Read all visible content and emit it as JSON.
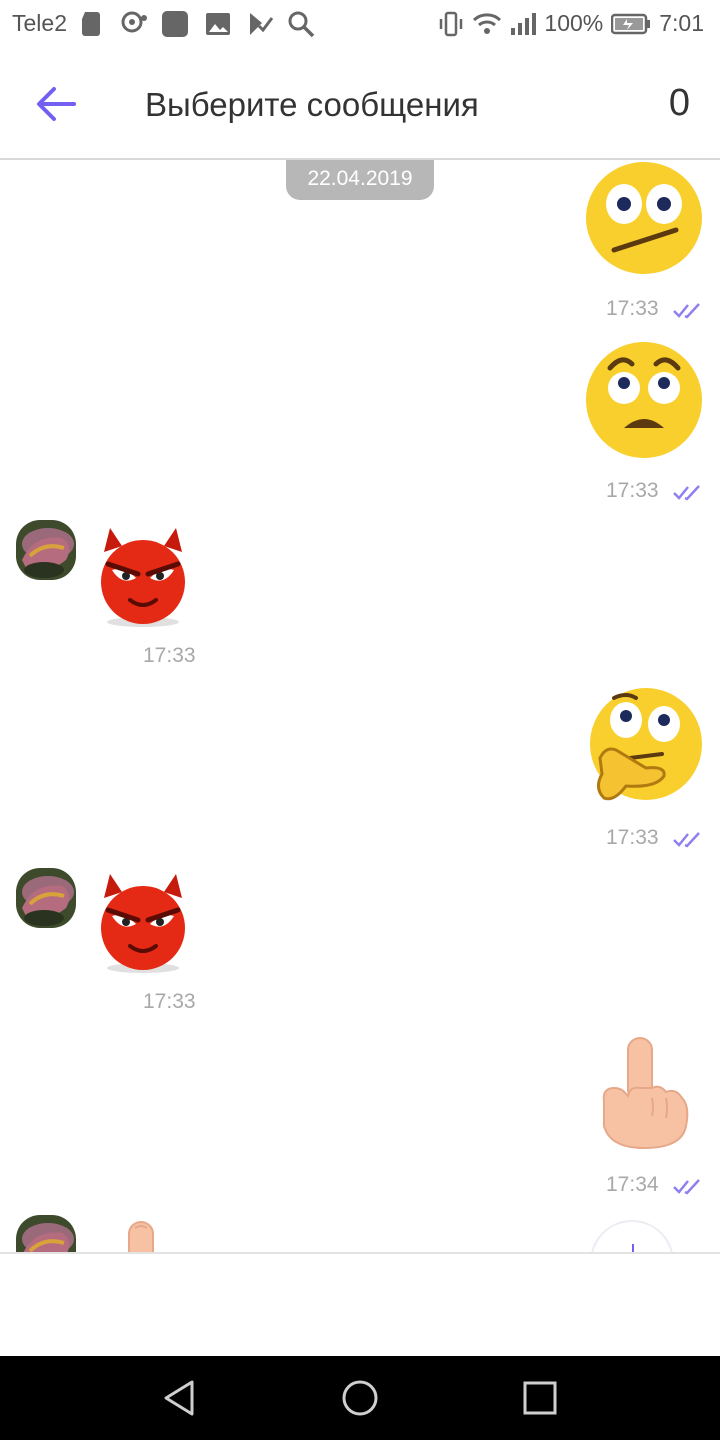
{
  "status_bar": {
    "carrier": "Tele2",
    "battery": "100%",
    "time": "7:01"
  },
  "header": {
    "title": "Выберите сообщения",
    "selected_count": "0"
  },
  "chat": {
    "date_separator": "22.04.2019",
    "messages": [
      {
        "direction": "outgoing",
        "sticker": "skeptical-face-sticker",
        "time": "17:33"
      },
      {
        "direction": "outgoing",
        "sticker": "worried-face-sticker",
        "time": "17:33"
      },
      {
        "direction": "incoming",
        "sticker": "devil-face-sticker",
        "time": "17:33"
      },
      {
        "direction": "outgoing",
        "sticker": "thinking-face-sticker",
        "time": "17:33"
      },
      {
        "direction": "incoming",
        "sticker": "devil-face-sticker",
        "time": "17:33"
      },
      {
        "direction": "outgoing",
        "sticker": "middle-finger-sticker",
        "time": "17:34"
      },
      {
        "direction": "incoming",
        "sticker": "finger-sticker",
        "time": ""
      }
    ]
  },
  "colors": {
    "accent": "#7360f2",
    "read_ticks": "#8f80f0",
    "date_pill": "#b7b7b7",
    "time_text": "#a8a8a8"
  }
}
